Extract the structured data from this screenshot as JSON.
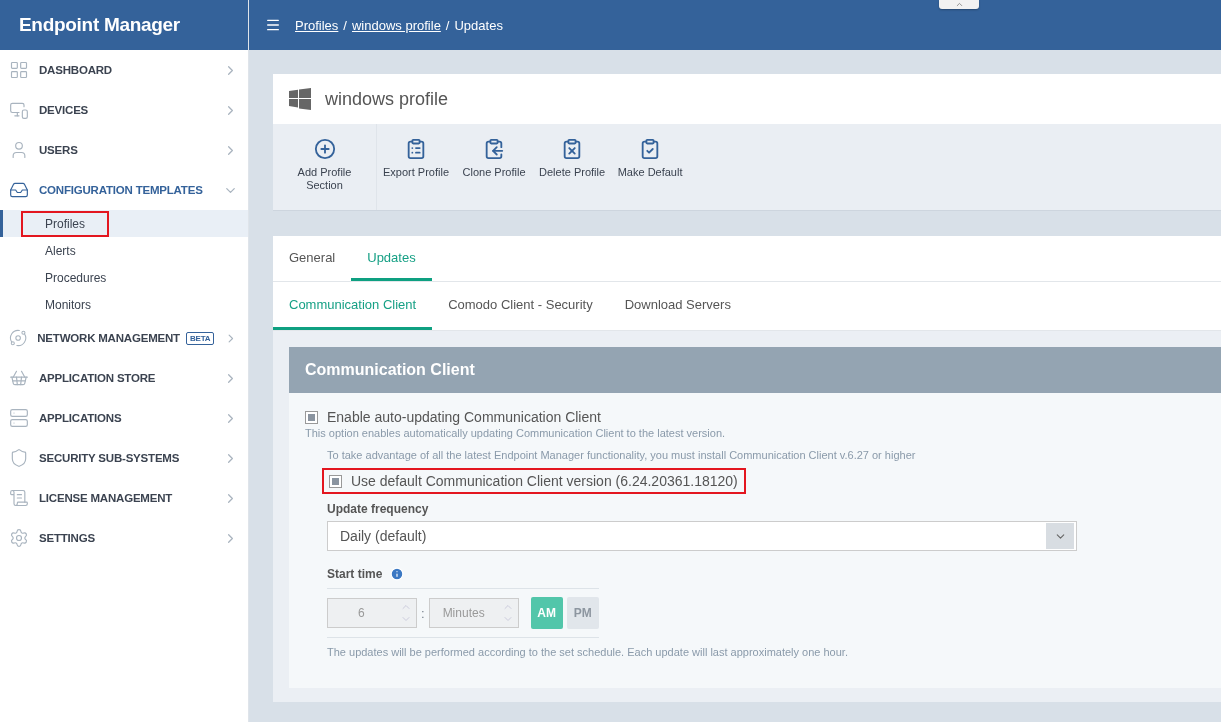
{
  "brand": "Endpoint Manager",
  "sidebar": {
    "items": [
      {
        "label": "DASHBOARD",
        "expanded": false
      },
      {
        "label": "DEVICES",
        "expanded": false
      },
      {
        "label": "USERS",
        "expanded": false
      },
      {
        "label": "CONFIGURATION TEMPLATES",
        "expanded": true,
        "children": [
          {
            "label": "Profiles",
            "selected": true,
            "annotated": true
          },
          {
            "label": "Alerts",
            "selected": false,
            "annotated": false
          },
          {
            "label": "Procedures",
            "selected": false,
            "annotated": false
          },
          {
            "label": "Monitors",
            "selected": false,
            "annotated": false
          }
        ]
      },
      {
        "label": "NETWORK MANAGEMENT",
        "expanded": false,
        "badge": "BETA"
      },
      {
        "label": "APPLICATION STORE",
        "expanded": false
      },
      {
        "label": "APPLICATIONS",
        "expanded": false
      },
      {
        "label": "SECURITY SUB-SYSTEMS",
        "expanded": false
      },
      {
        "label": "LICENSE MANAGEMENT",
        "expanded": false
      },
      {
        "label": "SETTINGS",
        "expanded": false
      }
    ]
  },
  "breadcrumb": [
    {
      "label": "Profiles",
      "kind": "link"
    },
    {
      "label": "/",
      "kind": "separator"
    },
    {
      "label": "windows profile",
      "kind": "link"
    },
    {
      "label": "/",
      "kind": "separator"
    },
    {
      "label": "Updates",
      "kind": "current"
    }
  ],
  "profile": {
    "title": "windows profile"
  },
  "toolbar": [
    "Add Profile Section",
    "Export Profile",
    "Clone Profile",
    "Delete Profile",
    "Make Default"
  ],
  "tabs": [
    {
      "label": "General",
      "selected": false
    },
    {
      "label": "Updates",
      "selected": true
    }
  ],
  "subtabs": [
    {
      "label": "Communication Client",
      "selected": true
    },
    {
      "label": "Comodo Client - Security",
      "selected": false
    },
    {
      "label": "Download Servers",
      "selected": false
    }
  ],
  "panel": {
    "title": "Communication Client",
    "enable": {
      "label": "Enable auto-updating Communication Client",
      "checked": true,
      "help": "This option enables automatically updating Communication Client to the latest version."
    },
    "notice": "To take advantage of all the latest Endpoint Manager functionality, you must install Communication Client v.6.27 or higher",
    "use_default": {
      "label": "Use default Communication Client version (6.24.20361.18120)",
      "checked": true,
      "annotated": true
    },
    "frequency": {
      "label": "Update frequency",
      "value": "Daily (default)"
    },
    "start_time": {
      "label": "Start time",
      "hour": "6",
      "separator": ":",
      "minutes_placeholder": "Minutes",
      "ampm": [
        {
          "label": "AM",
          "selected": true
        },
        {
          "label": "PM",
          "selected": false
        }
      ]
    },
    "footnote": "The updates will be performed according to the set schedule. Each update will last approximately one hour."
  }
}
